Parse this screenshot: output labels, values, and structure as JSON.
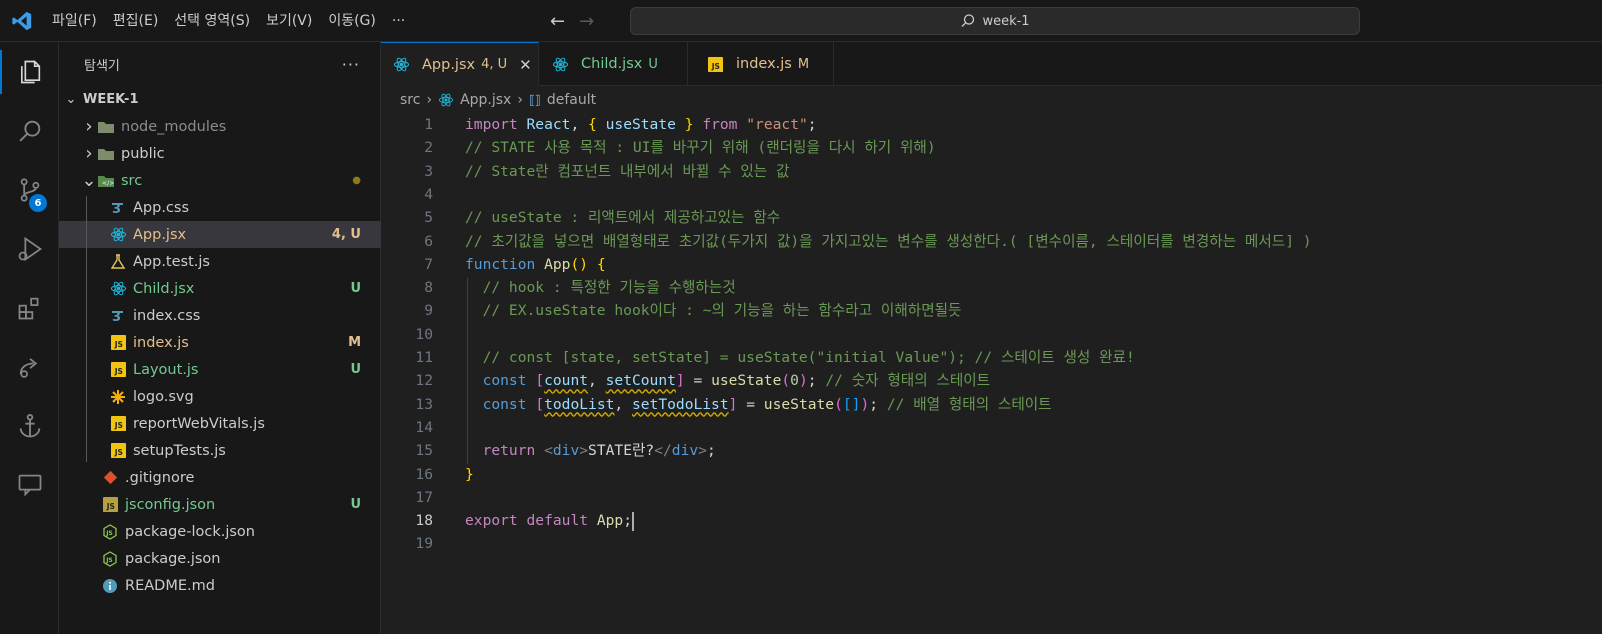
{
  "titlebar": {
    "menu": [
      "파일(F)",
      "편집(E)",
      "선택 영역(S)",
      "보기(V)",
      "이동(G)",
      "···"
    ],
    "search_text": "week-1"
  },
  "activity": {
    "scm_badge": "6",
    "icons": [
      "explorer-icon",
      "search-icon",
      "source-control-icon",
      "run-debug-icon",
      "extensions-icon",
      "remote-icon",
      "anchor-icon",
      "chat-icon"
    ]
  },
  "sidebar": {
    "title": "탐색기",
    "more": "···",
    "root": "WEEK-1",
    "items": [
      {
        "label": "node_modules",
        "kind": "folder",
        "color": "#8c8c8c",
        "status": "",
        "status_color": ""
      },
      {
        "label": "public",
        "kind": "folder",
        "color": "#cccccc",
        "status": "",
        "status_color": ""
      },
      {
        "label": "src",
        "kind": "folder-open",
        "color": "#73c991",
        "status": "●",
        "status_color": "#8a7a1a"
      },
      {
        "label": "App.css",
        "kind": "css",
        "color": "#cccccc",
        "status": "",
        "status_color": ""
      },
      {
        "label": "App.jsx",
        "kind": "react",
        "color": "#e2c08d",
        "status": "4, U",
        "status_color": "#e2c08d"
      },
      {
        "label": "App.test.js",
        "kind": "test",
        "color": "#cccccc",
        "status": "",
        "status_color": ""
      },
      {
        "label": "Child.jsx",
        "kind": "react",
        "color": "#73c991",
        "status": "U",
        "status_color": "#73c991"
      },
      {
        "label": "index.css",
        "kind": "css",
        "color": "#cccccc",
        "status": "",
        "status_color": ""
      },
      {
        "label": "index.js",
        "kind": "js",
        "color": "#e2c08d",
        "status": "M",
        "status_color": "#e2c08d"
      },
      {
        "label": "Layout.js",
        "kind": "js",
        "color": "#73c991",
        "status": "U",
        "status_color": "#73c991"
      },
      {
        "label": "logo.svg",
        "kind": "svg",
        "color": "#cccccc",
        "status": "",
        "status_color": ""
      },
      {
        "label": "reportWebVitals.js",
        "kind": "js",
        "color": "#cccccc",
        "status": "",
        "status_color": ""
      },
      {
        "label": "setupTests.js",
        "kind": "js",
        "color": "#cccccc",
        "status": "",
        "status_color": ""
      },
      {
        "label": ".gitignore",
        "kind": "git",
        "color": "#cccccc",
        "status": "",
        "status_color": ""
      },
      {
        "label": "jsconfig.json",
        "kind": "jsjson",
        "color": "#73c991",
        "status": "U",
        "status_color": "#73c991"
      },
      {
        "label": "package-lock.json",
        "kind": "node",
        "color": "#cccccc",
        "status": "",
        "status_color": ""
      },
      {
        "label": "package.json",
        "kind": "node",
        "color": "#cccccc",
        "status": "",
        "status_color": ""
      },
      {
        "label": "README.md",
        "kind": "info",
        "color": "#cccccc",
        "status": "",
        "status_color": ""
      }
    ]
  },
  "tabs": [
    {
      "label": "App.jsx",
      "suffix": "4, U",
      "kind": "react",
      "color": "#e2c08d",
      "active": true
    },
    {
      "label": "Child.jsx",
      "suffix": "U",
      "kind": "react",
      "color": "#73c991",
      "active": false
    },
    {
      "label": "index.js",
      "suffix": "M",
      "kind": "js",
      "color": "#e2c08d",
      "active": false
    }
  ],
  "breadcrumb": {
    "folder": "src",
    "file": "App.jsx",
    "symbol": "default"
  },
  "editor": {
    "current_line": 18,
    "lines": [
      [
        [
          "k",
          "import"
        ],
        [
          "w",
          " "
        ],
        [
          "id",
          "React"
        ],
        [
          "w",
          ", "
        ],
        [
          "y",
          "{"
        ],
        [
          "w",
          " "
        ],
        [
          "id",
          "useState"
        ],
        [
          "w",
          " "
        ],
        [
          "y",
          "}"
        ],
        [
          "w",
          " "
        ],
        [
          "k",
          "from"
        ],
        [
          "w",
          " "
        ],
        [
          "s",
          "\"react\""
        ],
        [
          "w",
          ";"
        ]
      ],
      [
        [
          "c",
          "// STATE 사용 목적 : UI를 바꾸기 위해 (랜더링을 다시 하기 위해)"
        ]
      ],
      [
        [
          "c",
          "// State란 컴포넌트 내부에서 바뀔 수 있는 값"
        ]
      ],
      [],
      [
        [
          "c",
          "// useState : 리액트에서 제공하고있는 함수"
        ]
      ],
      [
        [
          "c",
          "// 초기값을 넣으면 배열형태로 초기값(두가지 값)을 가지고있는 변수를 생성한다.( [변수이름, 스테이터를 변경하는 메서드] )"
        ]
      ],
      [
        [
          "b",
          "function"
        ],
        [
          "w",
          " "
        ],
        [
          "f",
          "App"
        ],
        [
          "y",
          "()"
        ],
        [
          "w",
          " "
        ],
        [
          "y",
          "{"
        ]
      ],
      [
        [
          "w",
          "  "
        ],
        [
          "c",
          "// hook : 특정한 기능을 수행하는것"
        ]
      ],
      [
        [
          "w",
          "  "
        ],
        [
          "c",
          "// EX.useState hook이다 : ~의 기능을 하는 함수라고 이해하면될듯"
        ]
      ],
      [],
      [
        [
          "w",
          "  "
        ],
        [
          "c",
          "// const [state, setState] = useState(\"initial Value\"); // 스테이트 생성 완료!"
        ]
      ],
      [
        [
          "w",
          "  "
        ],
        [
          "b",
          "const"
        ],
        [
          "w",
          " "
        ],
        [
          "p",
          "["
        ],
        [
          "id sq",
          "count"
        ],
        [
          "w",
          ", "
        ],
        [
          "id sq",
          "setCount"
        ],
        [
          "p",
          "]"
        ],
        [
          "w",
          " = "
        ],
        [
          "f",
          "useState"
        ],
        [
          "p",
          "("
        ],
        [
          "n",
          "0"
        ],
        [
          "p",
          ")"
        ],
        [
          "w",
          "; "
        ],
        [
          "c",
          "// 숫자 형태의 스테이트"
        ]
      ],
      [
        [
          "w",
          "  "
        ],
        [
          "b",
          "const"
        ],
        [
          "w",
          " "
        ],
        [
          "p",
          "["
        ],
        [
          "id sq",
          "todoList"
        ],
        [
          "w",
          ", "
        ],
        [
          "id sq",
          "setTodoList"
        ],
        [
          "p",
          "]"
        ],
        [
          "w",
          " = "
        ],
        [
          "f",
          "useState"
        ],
        [
          "p",
          "("
        ],
        [
          "bl",
          "[]"
        ],
        [
          "p",
          ")"
        ],
        [
          "w",
          "; "
        ],
        [
          "c",
          "// 배열 형태의 스테이트"
        ]
      ],
      [],
      [
        [
          "w",
          "  "
        ],
        [
          "k",
          "return"
        ],
        [
          "w",
          " "
        ],
        [
          "tg",
          "<"
        ],
        [
          "b",
          "div"
        ],
        [
          "tg",
          ">"
        ],
        [
          "w",
          "STATE란?"
        ],
        [
          "tg",
          "</"
        ],
        [
          "b",
          "div"
        ],
        [
          "tg",
          ">"
        ],
        [
          "w",
          ";"
        ]
      ],
      [
        [
          "y",
          "}"
        ]
      ],
      [],
      [
        [
          "k",
          "export"
        ],
        [
          "w",
          " "
        ],
        [
          "k",
          "default"
        ],
        [
          "w",
          " "
        ],
        [
          "f",
          "App"
        ],
        [
          "w",
          ";"
        ],
        [
          "cursor",
          ""
        ]
      ],
      []
    ]
  }
}
